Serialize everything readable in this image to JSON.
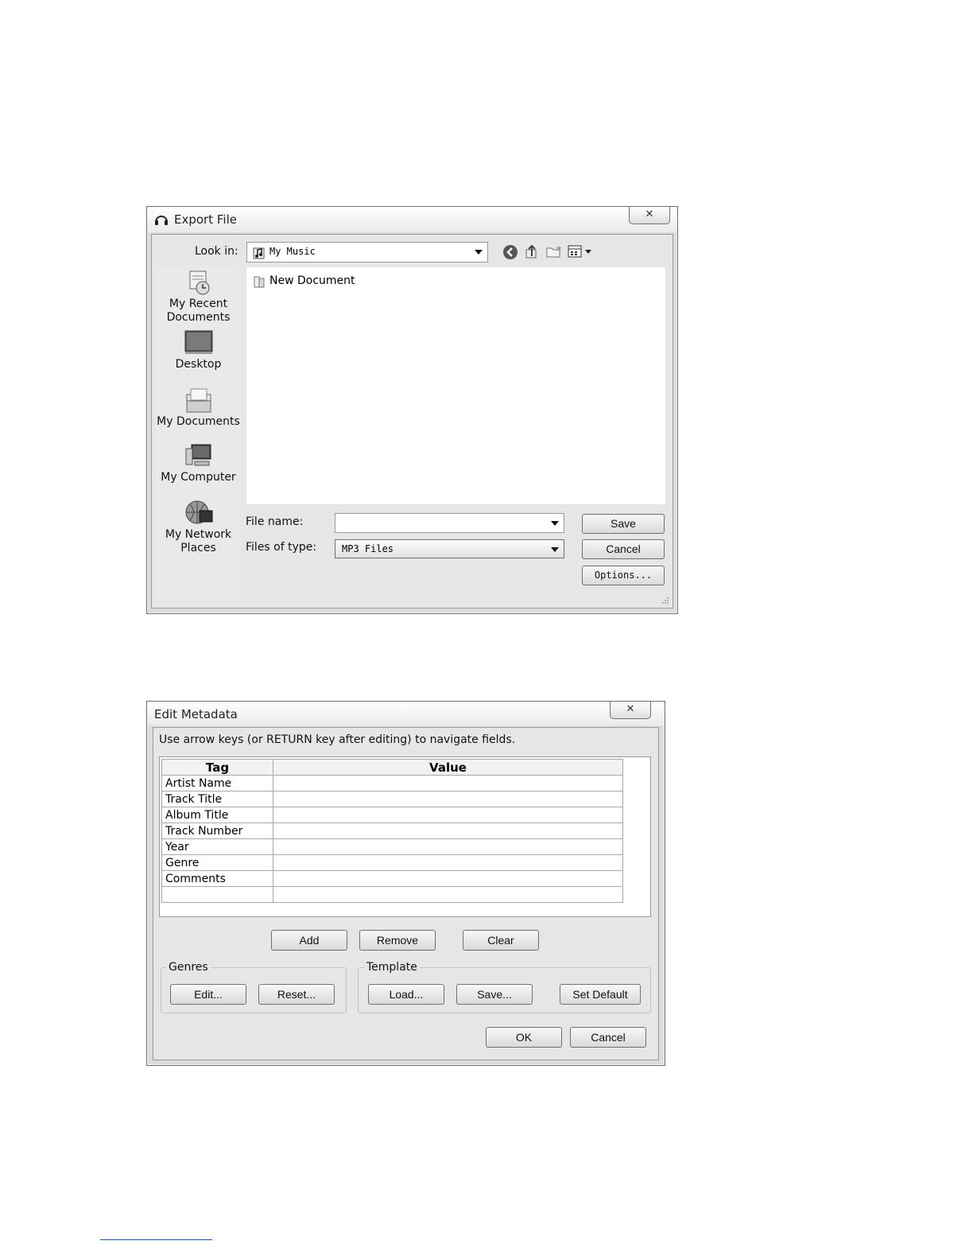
{
  "export_dialog": {
    "title": "Export File",
    "close_label": "X",
    "look_in_label": "Look in:",
    "look_in_value": "My Music",
    "places": [
      {
        "line1": "My Recent",
        "line2": "Documents"
      },
      {
        "line1": "Desktop",
        "line2": ""
      },
      {
        "line1": "My Documents",
        "line2": ""
      },
      {
        "line1": "My Computer",
        "line2": ""
      },
      {
        "line1": "My Network",
        "line2": "Places"
      }
    ],
    "files": [
      "New Document"
    ],
    "file_name_label": "File name:",
    "file_name_value": "",
    "file_type_label": "Files of type:",
    "file_type_value": "MP3 Files",
    "save_label": "Save",
    "cancel_label": "Cancel",
    "options_label": "Options..."
  },
  "metadata_dialog": {
    "title": "Edit Metadata",
    "close_label": "X",
    "instructions": "Use arrow keys (or RETURN key after editing) to navigate fields.",
    "columns": {
      "tag": "Tag",
      "value": "Value"
    },
    "rows": [
      {
        "tag": "Artist Name",
        "value": ""
      },
      {
        "tag": "Track Title",
        "value": ""
      },
      {
        "tag": "Album Title",
        "value": ""
      },
      {
        "tag": "Track Number",
        "value": ""
      },
      {
        "tag": "Year",
        "value": ""
      },
      {
        "tag": "Genre",
        "value": ""
      },
      {
        "tag": "Comments",
        "value": ""
      },
      {
        "tag": "",
        "value": ""
      }
    ],
    "add_label": "Add",
    "remove_label": "Remove",
    "clear_label": "Clear",
    "genres_title": "Genres",
    "genres_edit_label": "Edit...",
    "genres_reset_label": "Reset...",
    "template_title": "Template",
    "template_load_label": "Load...",
    "template_save_label": "Save...",
    "template_default_label": "Set Default",
    "ok_label": "OK",
    "cancel_label": "Cancel"
  }
}
